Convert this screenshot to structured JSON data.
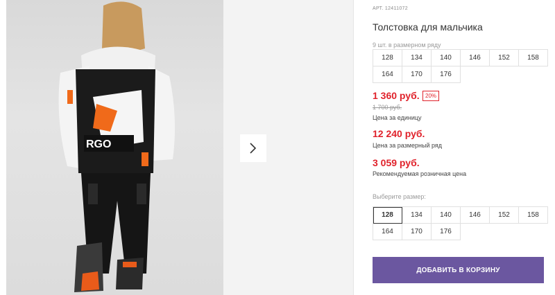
{
  "product": {
    "article": "АРТ. 12411072",
    "title": "Толстовка для мальчика",
    "row_count": "9 шт. в размерном ряду",
    "row_sizes": [
      "128",
      "134",
      "140",
      "146",
      "152",
      "158",
      "164",
      "170",
      "176"
    ]
  },
  "prices": {
    "unit_price": "1 360 руб.",
    "discount": "20%",
    "old_price": "1 700 руб.",
    "unit_label": "Цена за единицу",
    "row_price": "12 240 руб.",
    "row_label": "Цена за размерный ряд",
    "rrp_price": "3 059 руб.",
    "rrp_label": "Рекомендуемая розничная цена"
  },
  "size_picker": {
    "label": "Выберите размер:",
    "sizes": [
      "128",
      "134",
      "140",
      "146",
      "152",
      "158",
      "164",
      "170",
      "176"
    ],
    "selected": "128"
  },
  "cart": {
    "add_label": "ДОБАВИТЬ В КОРЗИНУ"
  },
  "colors": {
    "accent": "#6b57a0",
    "price": "#e0222b"
  },
  "icons": {
    "next": "chevron-right-icon"
  }
}
